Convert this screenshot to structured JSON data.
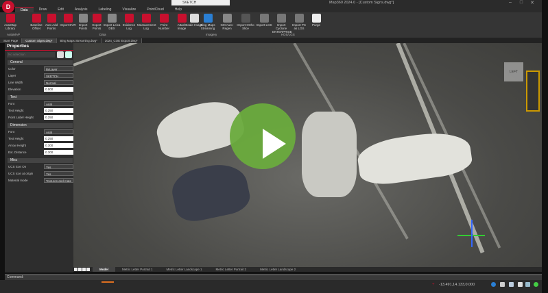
{
  "app": {
    "title": "Map360 2024.0 - [Custom Signs.dwg*]",
    "logo": "D",
    "layer_value": "SKETCH"
  },
  "window_controls": {
    "minimize": "–",
    "maximize": "□",
    "close": "✕"
  },
  "menu_tabs": [
    "Data",
    "Draw",
    "Edit",
    "Analysis",
    "Labeling",
    "Visualize",
    "PointCloud",
    "Help"
  ],
  "active_tab": "Data",
  "ribbon": {
    "buttons": [
      {
        "label": "AutoMap Library",
        "color": "#c8102e"
      },
      {
        "label": "Baseline Offset",
        "color": "#c8102e"
      },
      {
        "label": "Auto Add Points",
        "color": "#c8102e"
      },
      {
        "label": "Import EVR",
        "color": "#c8102e"
      },
      {
        "label": "Import Points",
        "color": "#888"
      },
      {
        "label": "Export Points",
        "color": "#c8102e"
      },
      {
        "label": "Import Leica DBX",
        "color": "#888"
      },
      {
        "label": "Evidence Log",
        "color": "#c8102e"
      },
      {
        "label": "Measurement Log",
        "color": "#c8102e"
      },
      {
        "label": "Point Number",
        "color": "#c8102e"
      },
      {
        "label": "Attach Image",
        "color": "#c8102e"
      },
      {
        "label": "Scale Image",
        "color": "#ddd"
      },
      {
        "label": "Bing Maps Streaming",
        "color": "#2a7fd4"
      },
      {
        "label": "GM Auto-Regen",
        "color": "#888"
      },
      {
        "label": "Import Ortho Slice",
        "color": "#555"
      },
      {
        "label": "Import LGS",
        "color": "#777"
      },
      {
        "label": "Import Cyclone ENTERPRISE",
        "color": "#777"
      },
      {
        "label": "Import PC as LGS",
        "color": "#777"
      },
      {
        "label": "Purge",
        "color": "#eee"
      }
    ],
    "groups": [
      "AutoMAP",
      "Data",
      "Imagery",
      "HDS/LGS"
    ]
  },
  "doc_tabs": [
    "Start Page",
    "Custom Signs.dwg*",
    "Bing Maps Streaming.dwg*",
    "2024_COE Export.dwg*"
  ],
  "properties": {
    "title": "Properties",
    "selection": "No selection",
    "sections": [
      {
        "name": "General",
        "rows": [
          [
            "Color",
            "ByLayer",
            true
          ],
          [
            "Layer",
            "SKETCH",
            true
          ],
          [
            "Line Width",
            "Normal",
            true
          ],
          [
            "Elevation",
            "0.000",
            false
          ]
        ]
      },
      {
        "name": "Text",
        "rows": [
          [
            "Font",
            "Arial",
            true
          ],
          [
            "Text Height",
            "0.250",
            false
          ],
          [
            "Point Label Height",
            "0.250",
            false
          ]
        ]
      },
      {
        "name": "Dimension",
        "rows": [
          [
            "Font",
            "Arial",
            true
          ],
          [
            "Text Height",
            "0.250",
            false
          ],
          [
            "Arrow Height",
            "0.300",
            false
          ],
          [
            "Ext. Distance",
            "0.300",
            false
          ]
        ]
      },
      {
        "name": "Misc",
        "rows": [
          [
            "UCS icon On",
            "Yes",
            true
          ],
          [
            "UCS icon at origin",
            "Yes",
            true
          ],
          [
            "Material mode",
            "Textures and mate",
            true
          ]
        ]
      }
    ]
  },
  "layout_tabs": [
    "Model",
    "Metric Letter Portrait 1",
    "Metric Letter Landscape 1",
    "Metric Letter Portrait 2",
    "Metric Letter Landscape 2"
  ],
  "command": {
    "label": "Command:"
  },
  "status": {
    "coordinates": "-13.491,14.133,0.000"
  },
  "viewcube": {
    "label": "LEFT"
  },
  "colors": {
    "accent": "#c8102e",
    "play": "#6aab3d"
  }
}
